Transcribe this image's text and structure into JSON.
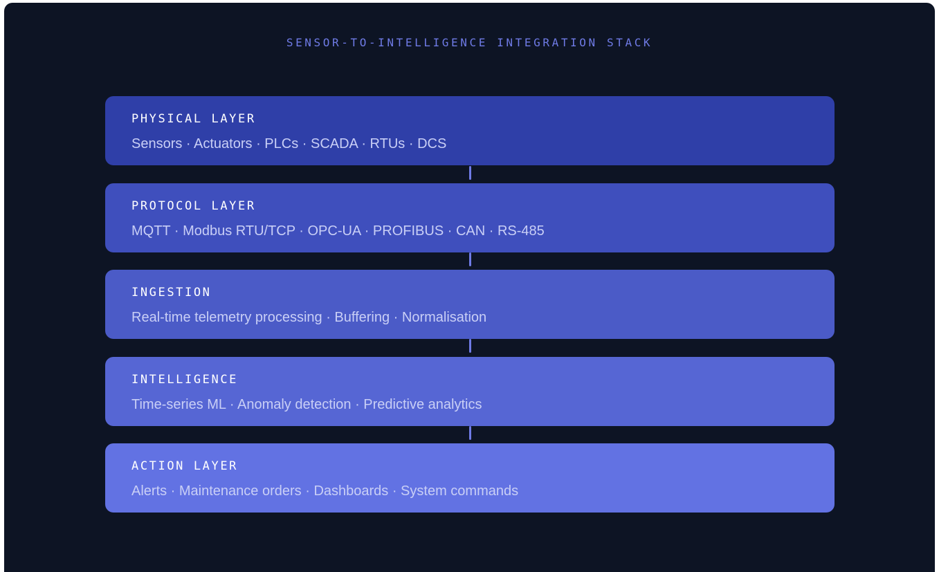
{
  "title": "SENSOR-TO-INTELLIGENCE INTEGRATION STACK",
  "layers": [
    {
      "name": "PHYSICAL LAYER",
      "items": "Sensors · Actuators · PLCs · SCADA · RTUs · DCS",
      "color": "#2f3fa8"
    },
    {
      "name": "PROTOCOL LAYER",
      "items": "MQTT · Modbus RTU/TCP · OPC-UA · PROFIBUS · CAN · RS-485",
      "color": "#3f4fbd"
    },
    {
      "name": "INGESTION",
      "items": "Real-time telemetry processing · Buffering · Normalisation",
      "color": "#4b5bc7"
    },
    {
      "name": "INTELLIGENCE",
      "items": "Time-series ML · Anomaly detection · Predictive analytics",
      "color": "#5666d4"
    },
    {
      "name": "ACTION LAYER",
      "items": "Alerts · Maintenance orders · Dashboards · System commands",
      "color": "#6272e3"
    }
  ],
  "colors": {
    "background": "#0d1424",
    "title": "#6f7be6",
    "connector": "#6f7be6",
    "layer_name": "#ffffff",
    "layer_items": "#c9cff6"
  }
}
